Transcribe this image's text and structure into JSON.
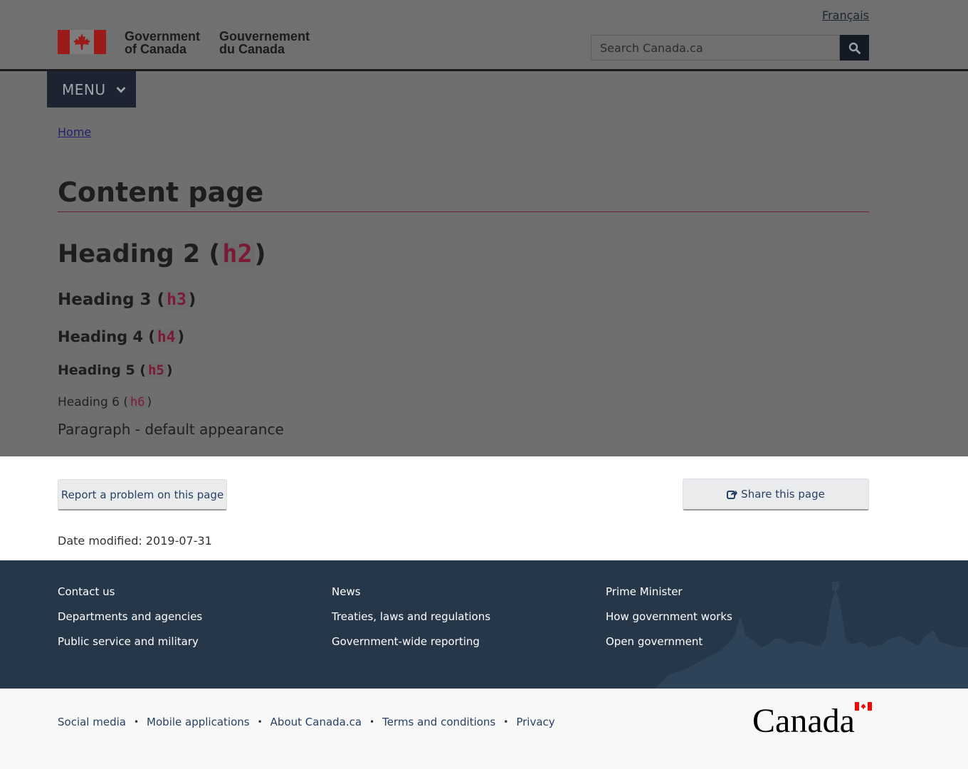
{
  "header": {
    "language_link": "Français",
    "signature_en_line1": "Government",
    "signature_en_line2": "of Canada",
    "signature_fr_line1": "Gouvernement",
    "signature_fr_line2": "du Canada",
    "search_placeholder": "Search Canada.ca",
    "menu_label": "MENU"
  },
  "breadcrumb": {
    "home": "Home"
  },
  "content": {
    "title": "Content page",
    "headings": [
      {
        "text": "Heading 2 (",
        "tag": "h2",
        "close": ")"
      },
      {
        "text": "Heading 3 (",
        "tag": "h3",
        "close": ")"
      },
      {
        "text": "Heading 4 (",
        "tag": "h4",
        "close": ")"
      },
      {
        "text": "Heading 5 (",
        "tag": "h5",
        "close": ")"
      },
      {
        "text": "Heading 6 (",
        "tag": "h6",
        "close": ")"
      }
    ],
    "paragraph": "Paragraph - default appearance"
  },
  "page_details": {
    "report_button": "Report a problem on this page",
    "share_button": "Share this page",
    "date_modified_label": "Date modified:",
    "date_modified_value": "2019-07-31"
  },
  "footer": {
    "col1": [
      "Contact us",
      "Departments and agencies",
      "Public service and military"
    ],
    "col2": [
      "News",
      "Treaties, laws and regulations",
      "Government-wide reporting"
    ],
    "col3": [
      "Prime Minister",
      "How government works",
      "Open government"
    ],
    "sub_links": [
      "Social media",
      "Mobile applications",
      "About Canada.ca",
      "Terms and conditions",
      "Privacy"
    ],
    "wordmark": "Canada"
  },
  "colors": {
    "overlay_grey": "#6f6f6f",
    "footer_dark": "#26374a",
    "link_blue": "#284162",
    "flag_red": "#ff0000"
  }
}
